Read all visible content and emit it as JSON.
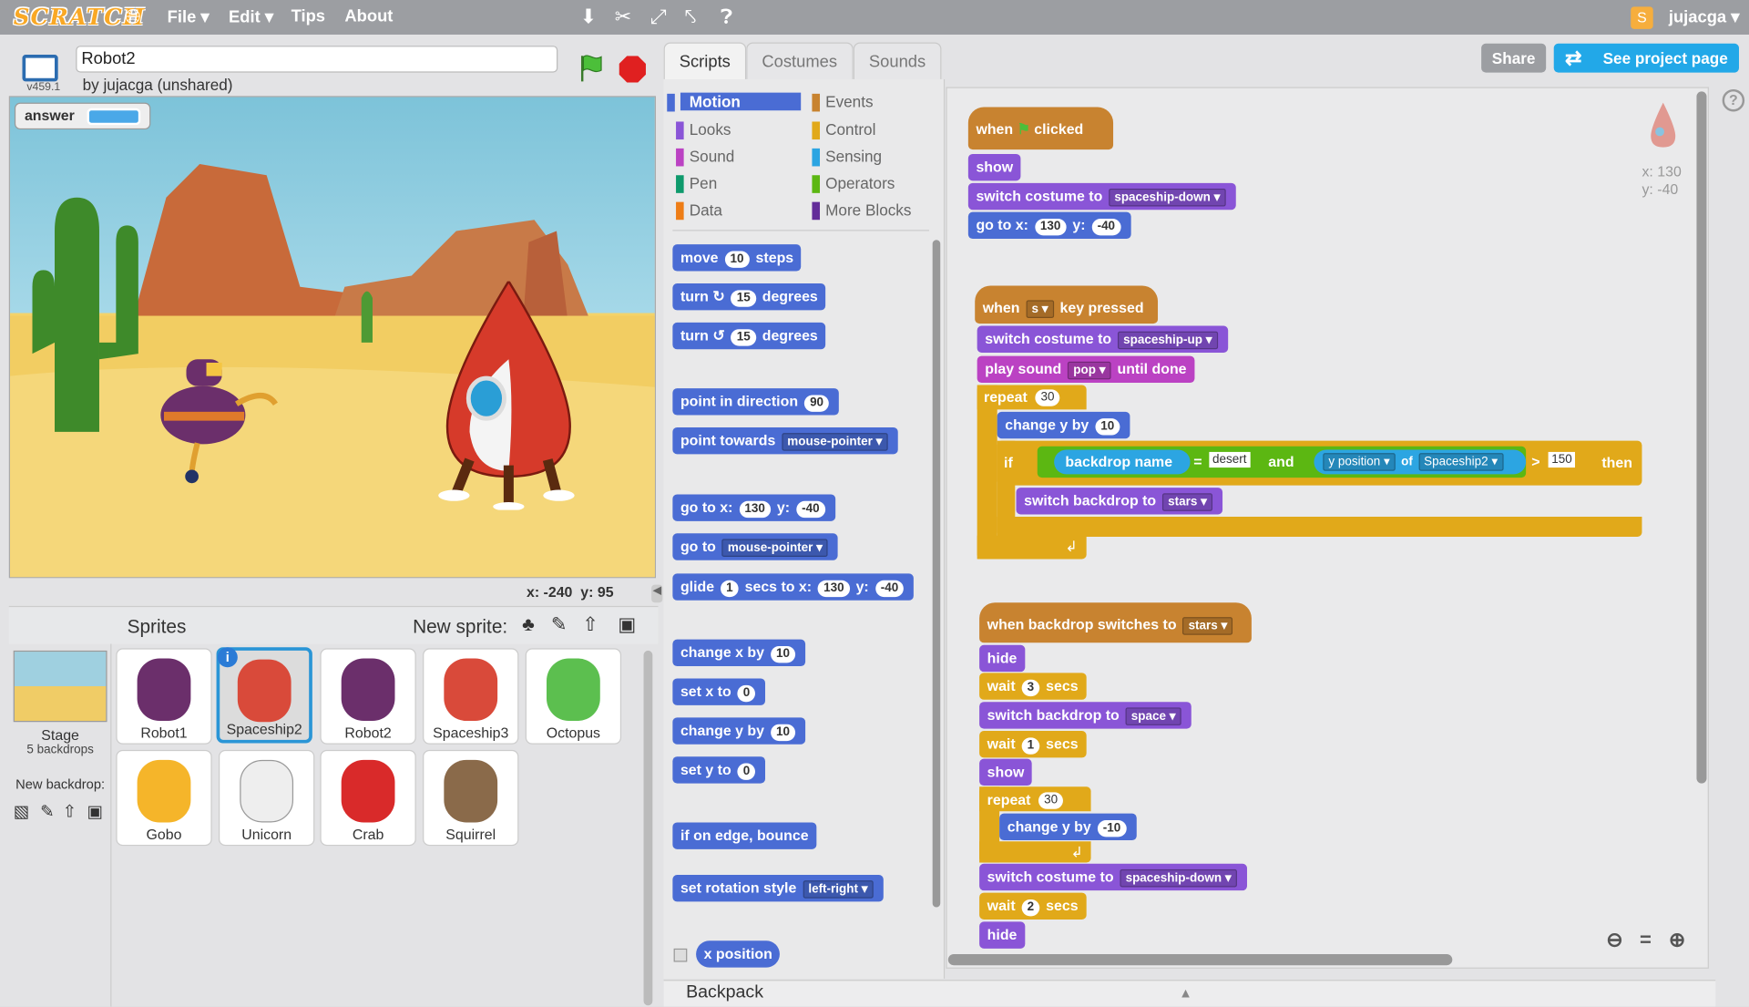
{
  "topbar": {
    "logo": "SCRATCH",
    "menus": [
      "File ▾",
      "Edit ▾",
      "Tips",
      "About"
    ],
    "user": "jujacga ▾"
  },
  "project": {
    "title": "Robot2",
    "byline": "by jujacga (unshared)",
    "version": "v459.1"
  },
  "stage": {
    "answer_label": "answer",
    "coords_x": "x: -240",
    "coords_y": "y: 95"
  },
  "sprites_pane": {
    "sprites_label": "Sprites",
    "new_sprite_label": "New sprite:",
    "stage_label": "Stage",
    "backdrops": "5 backdrops",
    "new_backdrop": "New backdrop:",
    "sprites": [
      {
        "name": "Robot1",
        "color": "#6b2f6b"
      },
      {
        "name": "Spaceship2",
        "color": "#d94a3a"
      },
      {
        "name": "Robot2",
        "color": "#6b2f6b"
      },
      {
        "name": "Spaceship3",
        "color": "#d94a3a"
      },
      {
        "name": "Octopus",
        "color": "#5cbf4f"
      },
      {
        "name": "Gobo",
        "color": "#f5b52a"
      },
      {
        "name": "Unicorn",
        "color": "#eeeeee"
      },
      {
        "name": "Crab",
        "color": "#d92a2a"
      },
      {
        "name": "Squirrel",
        "color": "#8a6a4a"
      }
    ]
  },
  "tabs": [
    "Scripts",
    "Costumes",
    "Sounds"
  ],
  "buttons": {
    "share": "Share",
    "see_project": "See project page"
  },
  "categories": {
    "left": [
      "Motion",
      "Looks",
      "Sound",
      "Pen",
      "Data"
    ],
    "right": [
      "Events",
      "Control",
      "Sensing",
      "Operators",
      "More Blocks"
    ]
  },
  "palette": {
    "move": [
      "move",
      "10",
      "steps"
    ],
    "turn_cw": [
      "turn",
      "15",
      "degrees"
    ],
    "turn_ccw": [
      "turn",
      "15",
      "degrees"
    ],
    "point_dir": [
      "point in direction",
      "90"
    ],
    "point_towards": [
      "point towards",
      "mouse-pointer"
    ],
    "goto_xy": [
      "go to x:",
      "130",
      "y:",
      "-40"
    ],
    "goto": [
      "go to",
      "mouse-pointer"
    ],
    "glide": [
      "glide",
      "1",
      "secs to x:",
      "130",
      "y:",
      "-40"
    ],
    "change_x": [
      "change x by",
      "10"
    ],
    "set_x": [
      "set x to",
      "0"
    ],
    "change_y": [
      "change y by",
      "10"
    ],
    "set_y": [
      "set y to",
      "0"
    ],
    "bounce": "if on edge, bounce",
    "rotation": [
      "set rotation style",
      "left-right"
    ],
    "xpos": "x position"
  },
  "script1": {
    "hat": [
      "when",
      "clicked"
    ],
    "show": "show",
    "costume": [
      "switch costume to",
      "spaceship-down"
    ],
    "goto": [
      "go to x:",
      "130",
      "y:",
      "-40"
    ]
  },
  "script2": {
    "hat": [
      "when",
      "s",
      "key pressed"
    ],
    "costume": [
      "switch costume to",
      "spaceship-up"
    ],
    "sound": [
      "play sound",
      "pop",
      "until done"
    ],
    "repeat": [
      "repeat",
      "30"
    ],
    "change_y": [
      "change y by",
      "10"
    ],
    "if": "if",
    "backdrop_name": "backdrop name",
    "eq": "=",
    "desert": "desert",
    "and": "and",
    "ypos": "y position",
    "of": "of",
    "spaceship2": "Spaceship2",
    "gt": ">",
    "150": "150",
    "then": "then",
    "switch_backdrop": [
      "switch backdrop to",
      "stars"
    ]
  },
  "script3": {
    "hat": [
      "when backdrop switches to",
      "stars"
    ],
    "hide": "hide",
    "wait3": [
      "wait",
      "3",
      "secs"
    ],
    "switch_backdrop": [
      "switch backdrop to",
      "space"
    ],
    "wait1": [
      "wait",
      "1",
      "secs"
    ],
    "show": "show",
    "repeat": [
      "repeat",
      "30"
    ],
    "change_y": [
      "change y by",
      "-10"
    ],
    "costume": [
      "switch costume to",
      "spaceship-down"
    ],
    "wait2": [
      "wait",
      "2",
      "secs"
    ],
    "hide2": "hide"
  },
  "ghost": {
    "x": "x: 130",
    "y": "y: -40"
  },
  "backpack": "Backpack"
}
